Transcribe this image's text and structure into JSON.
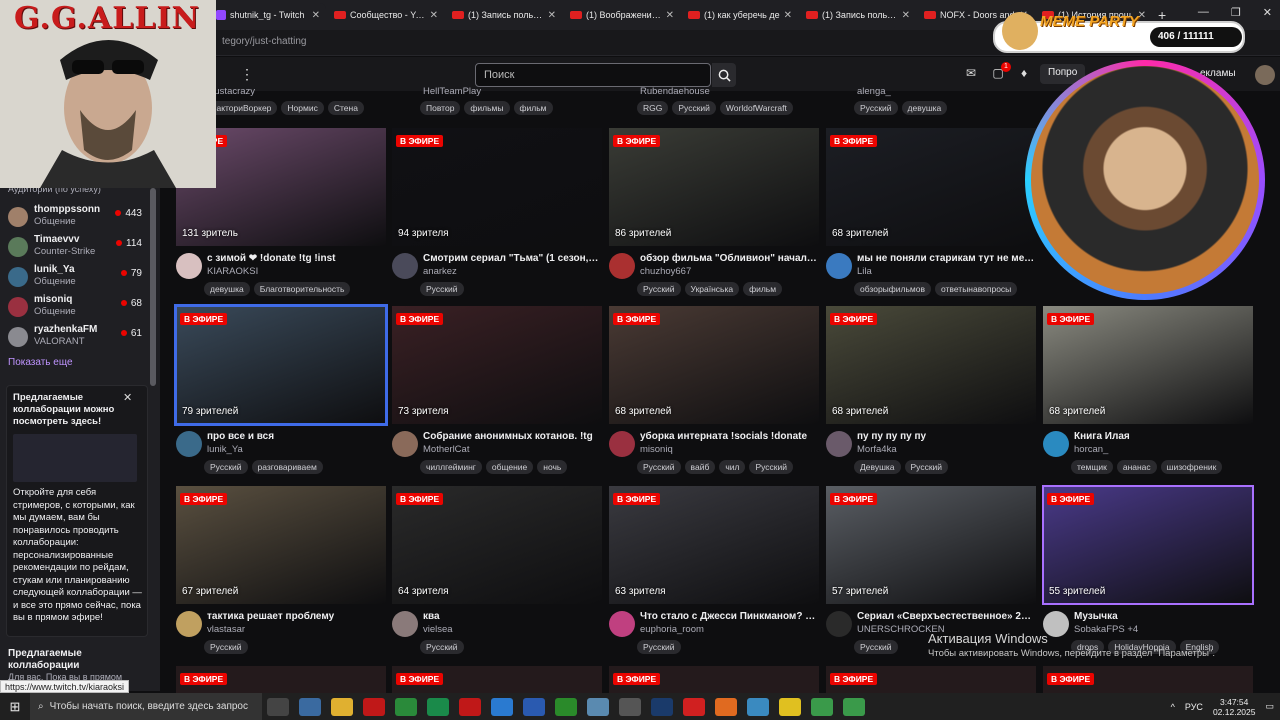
{
  "browser": {
    "tabs": [
      {
        "label": "shutnik_tg - Twitch",
        "kind": "twitch"
      },
      {
        "label": "Сообщество - YouTube",
        "kind": "yt"
      },
      {
        "label": "(1) Запись пользователя",
        "kind": "yt"
      },
      {
        "label": "(1) Воображение! а",
        "kind": "yt"
      },
      {
        "label": "(1) как уберечь де",
        "kind": "yt"
      },
      {
        "label": "(1) Запись пользов",
        "kind": "yt"
      },
      {
        "label": "NOFX - Doors and",
        "kind": "yt"
      },
      {
        "label": "(1) История прош",
        "kind": "yt"
      }
    ],
    "new_tab": "+",
    "url": "tegory/just-chatting"
  },
  "twitch_nav": {
    "search_placeholder": "Поиск",
    "prime_label": "Попро",
    "ads_label": "екламы",
    "notif_count": "1"
  },
  "sidebar": {
    "section_label": "Аудитории (по успеху)",
    "channels": [
      {
        "name": "thomppssonn",
        "game": "Общение",
        "viewers": "443",
        "color": "#a0806a"
      },
      {
        "name": "Timaevvv",
        "game": "Counter-Strike",
        "viewers": "114",
        "color": "#5a7a5a"
      },
      {
        "name": "lunik_Ya",
        "game": "Общение",
        "viewers": "79",
        "color": "#3a6a8a"
      },
      {
        "name": "misoniq",
        "game": "Общение",
        "viewers": "68",
        "color": "#9a3040"
      },
      {
        "name": "ryazhenkaFM",
        "game": "VALORANT",
        "viewers": "61",
        "color": "#8a8a90"
      }
    ],
    "show_more": "Показать еще",
    "collab": {
      "title": "Предлагаемые коллаборации можно посмотреть здесь!",
      "text": "Откройте для себя стримеров, с которыми, как мы думаем, вам бы понравилось проводить коллаборации: персонализированные рекомендации по рейдам, стукам или планированию следующей коллаборации — и все это прямо сейчас, пока вы в прямом эфире!"
    },
    "collab2_title": "Предлагаемые коллаборации",
    "collab2_sub": "Для вас. Пока вы в прямом",
    "status_url": "https://www.twitch.tv/kiaraoksi"
  },
  "overlay": {
    "left_title": "G.G.ALLIN",
    "meme_label": "MEME PARTY",
    "meme_count": "406 / 111111"
  },
  "top_row": [
    {
      "name": "juustacrazy",
      "tags": [
        "ФакториВоркер",
        "Нормис",
        "Стена"
      ]
    },
    {
      "name": "HellTeamPlay",
      "tags": [
        "Повтор",
        "фильмы",
        "фильм"
      ]
    },
    {
      "name": "Rubendaehouse",
      "tags": [
        "RGG",
        "Русский",
        "WorldofWarcraft"
      ]
    },
    {
      "name": "alenga_",
      "tags": [
        "Русский",
        "девушка"
      ]
    }
  ],
  "live_label": "В ЭФИРЕ",
  "streams": [
    {
      "viewers": "131 зритель",
      "title": "с зимой ❤ !donate !tg !inst",
      "name": "KIARAOKSI",
      "tags": [
        "девушка",
        "Благотворительность"
      ],
      "thumb": "#6b4a6a",
      "avatar": "#d8c0c0"
    },
    {
      "viewers": "94 зрителя",
      "title": "Смотрим сериал \"Тьма\" (1 сезон, 4 с...",
      "name": "anarkez",
      "tags": [
        "Русский"
      ],
      "thumb": "#101014",
      "avatar": "#4a4a5a"
    },
    {
      "viewers": "86 зрителей",
      "title": "обзор фильма \"Обливион\" начало 0...",
      "name": "chuzhoy667",
      "tags": [
        "Русский",
        "Українська",
        "фильм"
      ],
      "thumb": "#3a3c36",
      "avatar": "#aa3030"
    },
    {
      "viewers": "68 зрителей",
      "title": "мы не поняли старикам тут не место",
      "name": "Lila",
      "tags": [
        "обзорыфильмов",
        "ответынавопросы"
      ],
      "thumb": "#1c1e24",
      "avatar": "#3a7ac0"
    },
    {
      "viewers": "79 зрителей",
      "title": "про все и вся",
      "name": "lunik_Ya",
      "tags": [
        "Русский",
        "разговариваем"
      ],
      "thumb": "#3a4a5a",
      "avatar": "#3a6a8a"
    },
    {
      "viewers": "73 зрителя",
      "title": "Собрание анонимных котанов. !tg",
      "name": "MotherlCat",
      "tags": [
        "чиллгейминг",
        "общение",
        "ночь"
      ],
      "thumb": "#3a2024",
      "avatar": "#8a6a5a"
    },
    {
      "viewers": "68 зрителей",
      "title": "уборка интерната !socials !donate",
      "name": "misoniq",
      "tags": [
        "Русский",
        "вайб",
        "чил",
        "Русский"
      ],
      "thumb": "#4a3a34",
      "avatar": "#9a3040"
    },
    {
      "viewers": "68 зрителей",
      "title": "пу пу пу пу пу",
      "name": "Morfa4ka",
      "tags": [
        "Девушка",
        "Русский"
      ],
      "thumb": "#4a4a3a",
      "avatar": "#6a5a6a"
    },
    {
      "viewers": "68 зрителей",
      "title": "Книга Илая",
      "name": "horcan_",
      "tags": [
        "темщик",
        "ананас",
        "шизофреник"
      ],
      "thumb": "#8a8a80",
      "avatar": "#2a8ac0"
    },
    {
      "viewers": "67 зрителей",
      "title": "тактика решает проблему",
      "name": "vlastasar",
      "tags": [
        "Русский"
      ],
      "thumb": "#5a5040",
      "avatar": "#c0a060"
    },
    {
      "viewers": "64 зрителя",
      "title": "ква",
      "name": "vielsea",
      "tags": [
        "Русский"
      ],
      "thumb": "#2a2a2a",
      "avatar": "#8a7a7a"
    },
    {
      "viewers": "63 зрителя",
      "title": "Что стало с Джесси Пинкманом? !ф...",
      "name": "euphoria_room",
      "tags": [
        "Русский"
      ],
      "thumb": "#3a3a40",
      "avatar": "#c04080"
    },
    {
      "viewers": "57 зрителей",
      "title": "Сериал «Сверхъестественное» 200...",
      "name": "UNERSCHROCKEN",
      "tags": [
        "Русский"
      ],
      "thumb": "#5a5e64",
      "avatar": "#2a2a2a"
    },
    {
      "viewers": "55 зрителей",
      "title": "Музычка",
      "name": "SobakaFPS +4",
      "tags": [
        "drops",
        "HolidayHoppia",
        "English"
      ],
      "thumb": "#4a3a8a",
      "avatar": "#c0c0c0"
    }
  ],
  "windows": {
    "activation_title": "Активация Windows",
    "activation_text": "Чтобы активировать Windows, перейдите в раздел \"Параметры\".",
    "search_placeholder": "Чтобы начать поиск, введите здесь запрос",
    "lang": "РУС",
    "time": "3:47:54",
    "date": "02.12.2025"
  }
}
